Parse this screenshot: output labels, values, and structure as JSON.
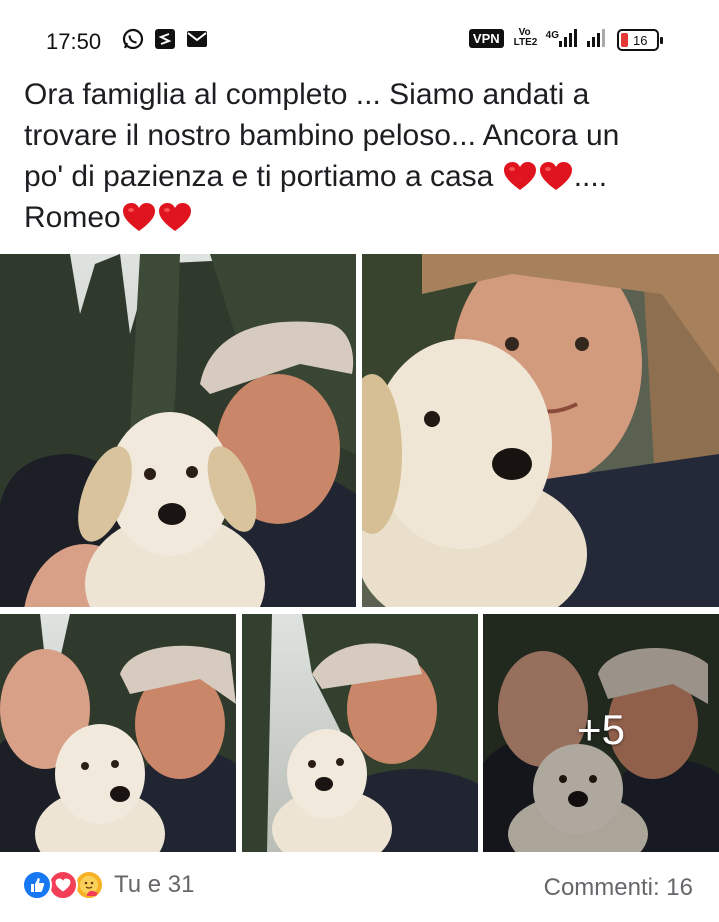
{
  "status_bar": {
    "time": "17:50",
    "left_icons": [
      "whatsapp-icon",
      "app-s-icon",
      "mail-icon"
    ],
    "vpn_label": "VPN",
    "volte_label": "Vo LTE2",
    "network_label": "4G",
    "battery_level": "16"
  },
  "post": {
    "text_line1": "Ora famiglia al completo ... Siamo andati a",
    "text_line2": "trovare il nostro bambino peloso... Ancora un",
    "text_line3": "po' di pazienza e ti portiamo a casa",
    "text_line3_end": "....",
    "text_line4": "Romeo",
    "emoji": "red-heart-icon"
  },
  "photos": {
    "more_count": "+5"
  },
  "footer": {
    "reaction_icons": [
      "like-icon",
      "love-icon",
      "care-icon"
    ],
    "reactions_text": "Tu e 31",
    "comments_text": "Commenti: 16"
  },
  "colors": {
    "like": "#1877f2",
    "love": "#f33e58",
    "care": "#f7b125",
    "heart": "#e0141e"
  }
}
